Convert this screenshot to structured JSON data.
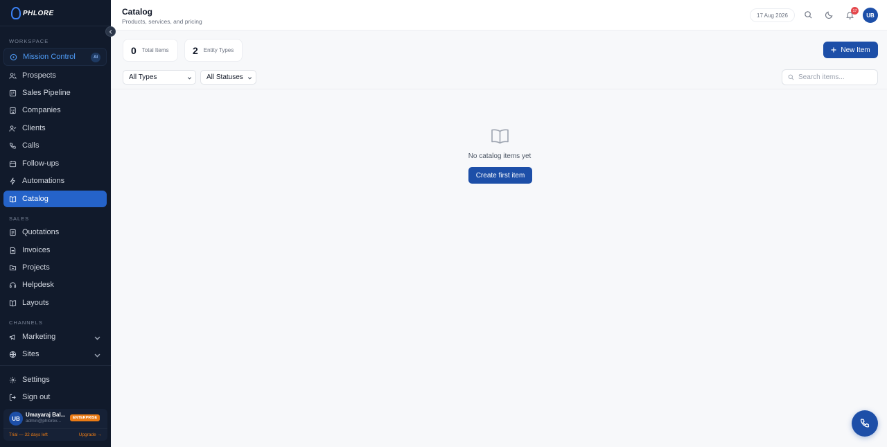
{
  "brand": {
    "name": "PHLORE"
  },
  "sidebar": {
    "sections": {
      "workspace": "WORKSPACE",
      "sales": "SALES",
      "channels": "CHANNELS"
    },
    "mission_control": {
      "label": "Mission Control",
      "badge": "AI"
    },
    "workspace_items": [
      {
        "label": "Prospects",
        "icon": "users-icon"
      },
      {
        "label": "Sales Pipeline",
        "icon": "kanban-icon"
      },
      {
        "label": "Companies",
        "icon": "building-icon"
      },
      {
        "label": "Clients",
        "icon": "user-check-icon"
      },
      {
        "label": "Calls",
        "icon": "phone-icon"
      },
      {
        "label": "Follow-ups",
        "icon": "calendar-icon"
      },
      {
        "label": "Automations",
        "icon": "zap-icon"
      },
      {
        "label": "Catalog",
        "icon": "book-icon",
        "active": true
      }
    ],
    "sales_items": [
      {
        "label": "Quotations",
        "icon": "file-icon"
      },
      {
        "label": "Invoices",
        "icon": "file-text-icon"
      },
      {
        "label": "Projects",
        "icon": "folder-icon"
      },
      {
        "label": "Helpdesk",
        "icon": "headset-icon"
      },
      {
        "label": "Layouts",
        "icon": "layout-icon"
      }
    ],
    "channel_items": [
      {
        "label": "Marketing",
        "icon": "megaphone-icon"
      },
      {
        "label": "Sites",
        "icon": "globe-icon"
      }
    ],
    "settings_label": "Settings",
    "signout_label": "Sign out",
    "user": {
      "initials": "UB",
      "name": "Umayaraj Bal...",
      "email": "admin@phlorex...",
      "plan": "ENTERPRISE",
      "trial": "Trial — 32 days left",
      "upgrade": "Upgrade →"
    }
  },
  "header": {
    "title": "Catalog",
    "subtitle": "Products, services, and pricing",
    "date": "17 Aug 2026",
    "notification_count": "17",
    "avatar_initials": "UB"
  },
  "stats": [
    {
      "value": "0",
      "label": "Total Items"
    },
    {
      "value": "2",
      "label": "Entity Types"
    }
  ],
  "new_item_label": "New Item",
  "filters": {
    "type": "All Types",
    "status": "All Statuses",
    "search_placeholder": "Search items..."
  },
  "empty_state": {
    "message": "No catalog items yet",
    "button": "Create first item"
  },
  "colors": {
    "accent": "#1d4fa8",
    "sidebar_bg": "#111a2b",
    "active_nav": "#2563c9",
    "enterprise_badge": "#ea7b15"
  }
}
